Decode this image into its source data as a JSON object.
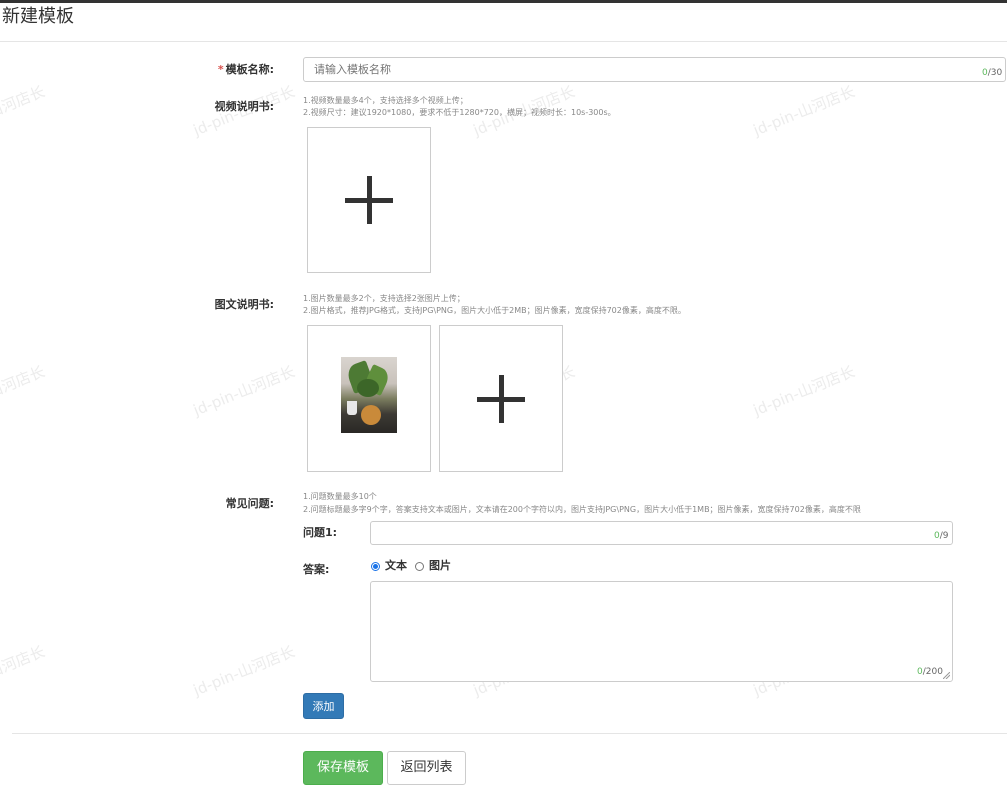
{
  "page": {
    "title": "新建模板"
  },
  "form": {
    "name": {
      "required_mark": "*",
      "label": "模板名称:",
      "placeholder": "请输入模板名称",
      "count_current": "0",
      "count_max": "/30"
    },
    "video": {
      "label": "视频说明书:",
      "hint_line1": "1.视频数量最多4个，支持选择多个视频上传；",
      "hint_line2": "2.视频尺寸：建议1920*1080，要求不低于1280*720，横屏；视频时长：10s-300s。"
    },
    "image": {
      "label": "图文说明书:",
      "hint_line1": "1.图片数量最多2个，支持选择2张图片上传；",
      "hint_line2": "2.图片格式，推荐JPG格式，支持JPG\\PNG，图片大小低于2MB；图片像素，宽度保持702像素，高度不限。"
    },
    "faq": {
      "label": "常见问题:",
      "hint_line1": "1.问题数量最多10个",
      "hint_line2": "2.问题标题最多字9个字，答案支持文本或图片，文本请在200个字符以内，图片支持JPG\\PNG，图片大小低于1MB；图片像素，宽度保持702像素，高度不限",
      "question_label": "问题1:",
      "question_count_current": "0",
      "question_count_max": "/9",
      "answer_label": "答案:",
      "answer_type_text": "文本",
      "answer_type_image": "图片",
      "answer_selected": "文本",
      "answer_count_current": "0",
      "answer_count_max": "/200",
      "add_button": "添加"
    }
  },
  "footer": {
    "save_button": "保存模板",
    "back_button": "返回列表"
  },
  "watermark": "jd-pin-山河店长",
  "colors": {
    "primary": "#337ab7",
    "success": "#5cb85c",
    "required": "#d9534f",
    "radio_checked": "#1a73e8"
  },
  "icons": [
    "plus-icon",
    "plus-icon",
    "plus-icon",
    "resize-handle-icon"
  ]
}
